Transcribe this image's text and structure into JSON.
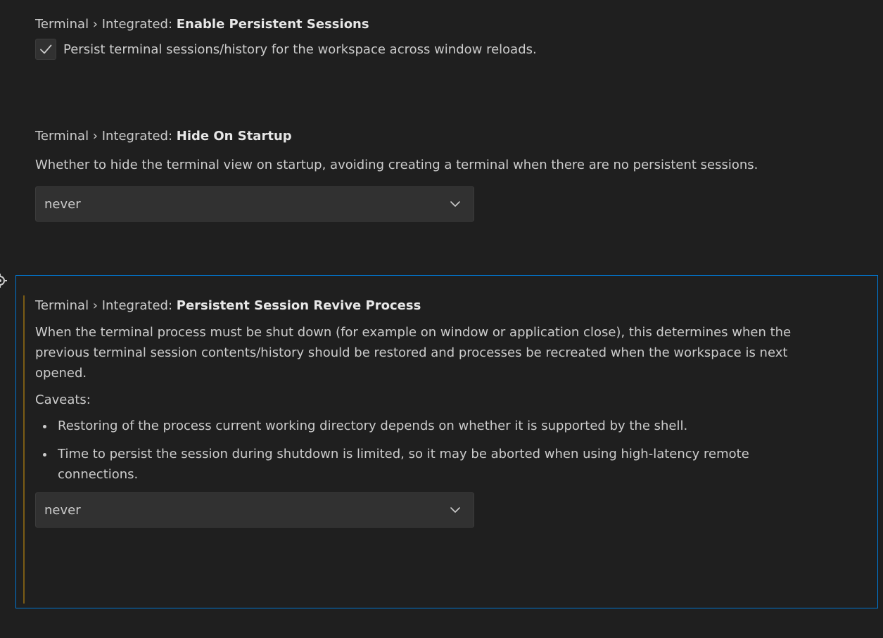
{
  "settings": [
    {
      "category": "Terminal › Integrated: ",
      "name": "Enable Persistent Sessions",
      "checkbox_label": "Persist terminal sessions/history for the workspace across window reloads.",
      "checked": true
    },
    {
      "category": "Terminal › Integrated: ",
      "name": "Hide On Startup",
      "description": "Whether to hide the terminal view on startup, avoiding creating a terminal when there are no persistent sessions.",
      "value": "never"
    },
    {
      "category": "Terminal › Integrated: ",
      "name": "Persistent Session Revive Process",
      "description": "When the terminal process must be shut down (for example on window or application close), this determines when the previous terminal session contents/history should be restored and processes be recreated when the workspace is next opened.",
      "caveats_label": "Caveats:",
      "caveats": [
        "Restoring of the process current working directory depends on whether it is supported by the shell.",
        "Time to persist the session during shutdown is limited, so it may be aborted when using high-latency remote connections."
      ],
      "value": "never"
    }
  ],
  "colors": {
    "background": "#1f1f1f",
    "focus_border": "#0078d4",
    "modified_indicator": "#7a5c15",
    "input_background": "#313131"
  },
  "icons": {
    "check": "check-icon",
    "dropdown": "chevron-down-icon",
    "gear": "gear-icon"
  }
}
